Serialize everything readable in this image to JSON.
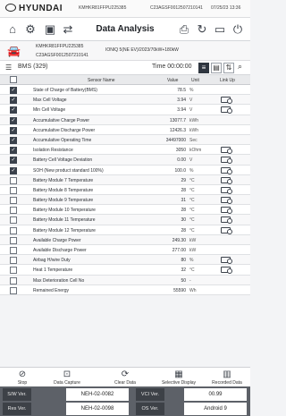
{
  "header": {
    "brand": "HYUNDAI",
    "code_a": "KMHKR81FFPU225385",
    "code_b": "C23AGSF0012507210141",
    "datetime": "07/25/23 13:36"
  },
  "nav": {
    "title": "Data Analysis"
  },
  "vehicle": {
    "vin": "KMHKR81FFPU225385",
    "model": "IONIQ 5(NE EV)/2023/70kW+180kW",
    "code": "C23AGSF0012507210141"
  },
  "toolbar": {
    "module": "BMS (329)",
    "time_label": "Time 00:00:00"
  },
  "table": {
    "headers": {
      "name": "Sensor Name",
      "value": "Value",
      "unit": "Unit",
      "link": "Link Up"
    },
    "rows": [
      {
        "checked": true,
        "name": "State of Charge of Battery(BMS)",
        "value": "78.5",
        "unit": "%",
        "link": false
      },
      {
        "checked": true,
        "name": "Max Cell Voltage",
        "value": "3.94",
        "unit": "V",
        "link": true
      },
      {
        "checked": true,
        "name": "Min Cell Voltage",
        "value": "3.94",
        "unit": "V",
        "link": true
      },
      {
        "checked": true,
        "name": "Accumulative Charge Power",
        "value": "13077.7",
        "unit": "kWh",
        "link": false
      },
      {
        "checked": true,
        "name": "Accumulative Discharge Power",
        "value": "12426.3",
        "unit": "kWh",
        "link": false
      },
      {
        "checked": true,
        "name": "Accumulative Operating Time",
        "value": "34497000",
        "unit": "Sec",
        "link": false
      },
      {
        "checked": true,
        "name": "Isolation Resistance",
        "value": "3050",
        "unit": "kOhm",
        "link": true
      },
      {
        "checked": true,
        "name": "Battery Cell Voltage Deviation",
        "value": "0.00",
        "unit": "V",
        "link": true
      },
      {
        "checked": true,
        "name": "SOH (New product standard 100%)",
        "value": "100.0",
        "unit": "%",
        "link": true
      },
      {
        "checked": false,
        "name": "Battery Module 7 Temperature",
        "value": "29",
        "unit": "°C",
        "link": true
      },
      {
        "checked": false,
        "name": "Battery Module 8 Temperature",
        "value": "28",
        "unit": "°C",
        "link": true
      },
      {
        "checked": false,
        "name": "Battery Module 9 Temperature",
        "value": "31",
        "unit": "°C",
        "link": true
      },
      {
        "checked": false,
        "name": "Battery Module 10 Temperature",
        "value": "28",
        "unit": "°C",
        "link": true
      },
      {
        "checked": false,
        "name": "Battery Module 11 Temperature",
        "value": "30",
        "unit": "°C",
        "link": true
      },
      {
        "checked": false,
        "name": "Battery Module 12 Temperature",
        "value": "28",
        "unit": "°C",
        "link": true
      },
      {
        "checked": false,
        "name": "Available Charge Power",
        "value": "249.30",
        "unit": "kW",
        "link": false
      },
      {
        "checked": false,
        "name": "Available Discharge Power",
        "value": "277.00",
        "unit": "kW",
        "link": false
      },
      {
        "checked": false,
        "name": "Airbag H/wire Duty",
        "value": "80",
        "unit": "%",
        "link": true
      },
      {
        "checked": false,
        "name": "Heat 1 Temperature",
        "value": "32",
        "unit": "°C",
        "link": true
      },
      {
        "checked": false,
        "name": "Max Deterioration Cell No",
        "value": "50",
        "unit": "-",
        "link": false
      },
      {
        "checked": false,
        "name": "Remained Energy",
        "value": "55590",
        "unit": "Wh",
        "link": false
      }
    ]
  },
  "bottom": {
    "stop": "Stop",
    "data_capture": "Data Capture",
    "clear_data": "Clear Data",
    "selective_display": "Selective Display",
    "recorded_data": "Recorded Data"
  },
  "footer": {
    "sw_ver_label": "S/W Ver.",
    "sw_ver_value": "NEH-02-0082",
    "vci_ver_label": "VCI Ver.",
    "vci_ver_value": "00.99",
    "res_ver_label": "Res Ver.",
    "res_ver_value": "NEH-02-0098",
    "os_ver_label": "OS Ver.",
    "os_ver_value": "Android 9"
  }
}
